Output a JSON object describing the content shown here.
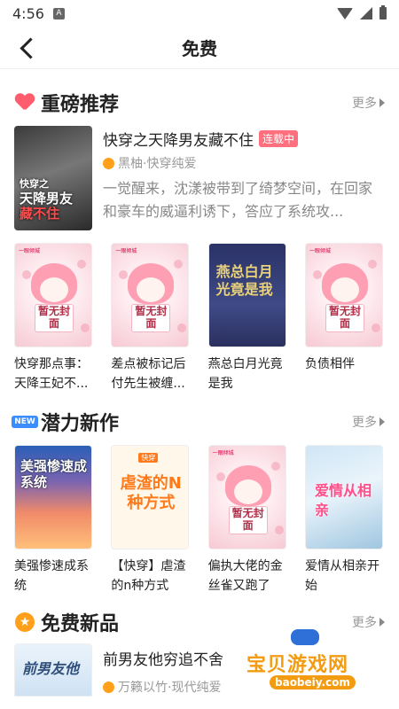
{
  "status": {
    "time": "4:56",
    "notif_letter": "A"
  },
  "nav": {
    "title": "免费"
  },
  "sections": {
    "recommend": {
      "title": "重磅推荐",
      "more": "更多"
    },
    "potential": {
      "title": "潜力新作",
      "more": "更多",
      "badge": "NEW"
    },
    "free_new": {
      "title": "免费新品",
      "more": "更多"
    }
  },
  "featured": {
    "title": "快穿之天降男友藏不住",
    "status_tag": "连载中",
    "author_category": "黑柚·快穿纯爱",
    "description": "一觉醒来，沈漾被带到了绮梦空间，在回家和豪车的威逼利诱下，答应了系统攻...",
    "cover_text_1": "快穿之",
    "cover_text_2": "天降男友",
    "cover_text_3": "藏不住"
  },
  "recommend_books": [
    {
      "title": "快穿那点事：天降王妃不...",
      "cover_text": "暂无封面"
    },
    {
      "title": "差点被标记后付先生被缠...",
      "cover_text": "暂无封面"
    },
    {
      "title": "燕总白月光竟是我",
      "cover_text": "燕总白月光竟是我"
    },
    {
      "title": "负债相伴",
      "cover_text": "暂无封面"
    }
  ],
  "potential_books": [
    {
      "title": "美强惨速成系统",
      "cover_text": "美强惨速成系统"
    },
    {
      "title": "【快穿】虐渣的n种方式",
      "cover_text": "虐渣的N种方式",
      "cover_tag": "快穿"
    },
    {
      "title": "偏执大佬的金丝雀又跑了",
      "cover_text": "暂无封面"
    },
    {
      "title": "爱情从相亲开始",
      "cover_text": "爱情从相亲"
    }
  ],
  "free_new_book": {
    "title": "前男友他穷追不舍",
    "author_category": "万籁以竹·现代纯爱",
    "cover_text": "前男友他"
  },
  "cover_brand": "一眼倾城",
  "watermark": {
    "name": "宝贝游戏网",
    "url": "baobeiy.com"
  },
  "colors": {
    "accent_pink": "#ff6f7d",
    "more_gray": "#999999",
    "new_blue": "#3b8cff",
    "star_orange": "#ff9f1a"
  }
}
